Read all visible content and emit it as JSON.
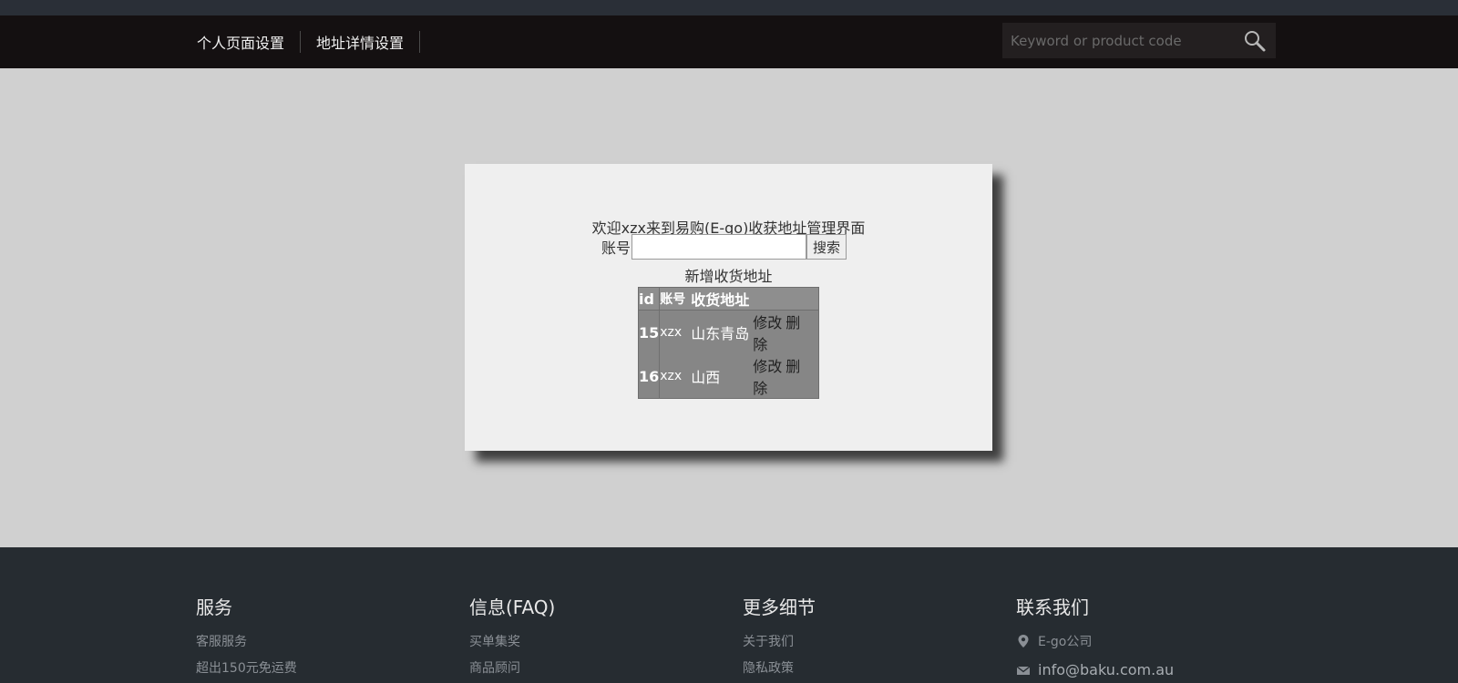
{
  "nav": {
    "links": [
      "个人页面设置",
      "地址详情设置"
    ],
    "search_placeholder": "Keyword or product code"
  },
  "panel": {
    "welcome": "欢迎xzx来到易购(E-go)收获地址管理界面",
    "account_label": "账号",
    "account_value": "",
    "search_button": "搜索",
    "add_link": "新增收货地址",
    "table": {
      "headers": [
        "id",
        "账号",
        "收货地址",
        ""
      ],
      "rows": [
        {
          "id": "15",
          "account": "xzx",
          "address": "山东青岛",
          "edit": "修改",
          "delete": "删除"
        },
        {
          "id": "16",
          "account": "xzx",
          "address": "山西",
          "edit": "修改",
          "delete": "删除"
        }
      ]
    }
  },
  "footer": {
    "service": {
      "title": "服务",
      "items": [
        "客服服务",
        "超出150元免运费"
      ]
    },
    "faq": {
      "title": "信息(FAQ)",
      "items": [
        "买单集奖",
        "商品顾问"
      ]
    },
    "more": {
      "title": "更多细节",
      "items": [
        "关于我们",
        "隐私政策"
      ]
    },
    "contact": {
      "title": "联系我们",
      "company": "E-go公司",
      "email": "info@baku.com.au"
    }
  },
  "icons": {
    "search": "search-icon",
    "location": "location-pin-icon",
    "email": "envelope-icon"
  },
  "colors": {
    "navbar": "#141011",
    "footer": "#262c31",
    "table": "#868686"
  }
}
